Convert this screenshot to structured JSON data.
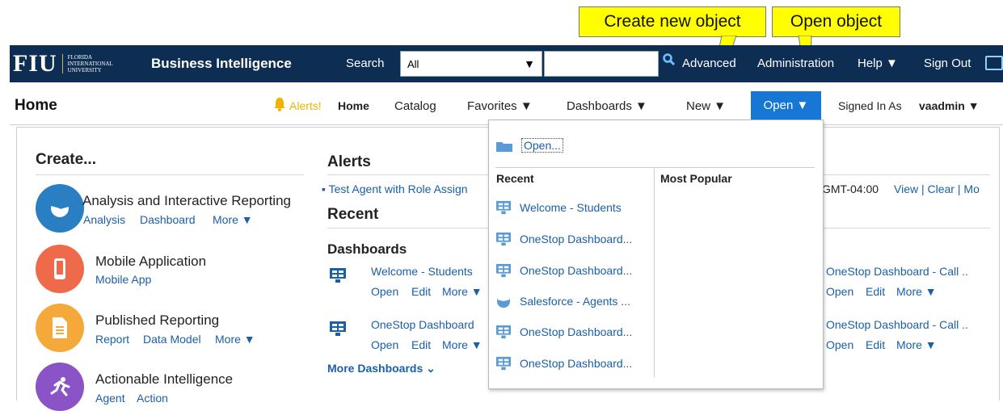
{
  "callouts": {
    "create": "Create new object",
    "open": "Open object"
  },
  "topbar": {
    "logo_mark": "FIU",
    "logo_line1": "FLORIDA",
    "logo_line2": "INTERNATIONAL",
    "logo_line3": "UNIVERSITY",
    "app_title": "Business Intelligence",
    "search_label": "Search",
    "search_scope": "All",
    "search_placeholder": "",
    "advanced": "Advanced",
    "administration": "Administration",
    "help": "Help ▼",
    "sign_out": "Sign Out"
  },
  "navbar": {
    "page_title": "Home",
    "alerts": "Alerts!",
    "home": "Home",
    "catalog": "Catalog",
    "favorites": "Favorites ▼",
    "dashboards": "Dashboards ▼",
    "new": "New ▼",
    "open": "Open ▼",
    "signed_in_as": "Signed In As",
    "user": "vaadmin ▼"
  },
  "create": {
    "heading": "Create...",
    "items": [
      {
        "title": "Analysis and Interactive Reporting",
        "links": [
          "Analysis",
          "Dashboard",
          "More ▼"
        ],
        "icon": "analysis-icon",
        "color": "#2a7fc2"
      },
      {
        "title": "Mobile Application",
        "links": [
          "Mobile App"
        ],
        "icon": "mobile-icon",
        "color": "#ef6a4a"
      },
      {
        "title": "Published Reporting",
        "links": [
          "Report",
          "Data Model",
          "More ▼"
        ],
        "icon": "report-icon",
        "color": "#f6a93b"
      },
      {
        "title": "Actionable Intelligence",
        "links": [
          "Agent",
          "Action"
        ],
        "icon": "runner-icon",
        "color": "#8b54c6"
      }
    ]
  },
  "alerts": {
    "heading": "Alerts",
    "item": "Test Agent with Role Assign",
    "time": "GMT-04:00",
    "view": "View",
    "clear": "Clear",
    "more": "Mo"
  },
  "recent": {
    "heading": "Recent",
    "dashboards_heading": "Dashboards",
    "items": [
      {
        "name": "Welcome - Students",
        "open": "Open",
        "edit": "Edit",
        "more": "More ▼"
      },
      {
        "name": "OneStop Dashboard",
        "open": "Open",
        "edit": "Edit",
        "more": "More ▼"
      }
    ],
    "right_items": [
      {
        "name": "OneStop Dashboard - Call ..",
        "open": "Open",
        "edit": "Edit",
        "more": "More ▼"
      },
      {
        "name": "OneStop Dashboard - Call ..",
        "open": "Open",
        "edit": "Edit",
        "more": "More ▼"
      }
    ],
    "more_dashboards": "More Dashboards"
  },
  "open_menu": {
    "open_item": "Open...",
    "recent_heading": "Recent",
    "popular_heading": "Most Popular",
    "recent_items": [
      "Welcome - Students",
      "OneStop Dashboard...",
      "OneStop Dashboard...",
      "Salesforce - Agents ...",
      "OneStop Dashboard...",
      "OneStop Dashboard..."
    ]
  }
}
